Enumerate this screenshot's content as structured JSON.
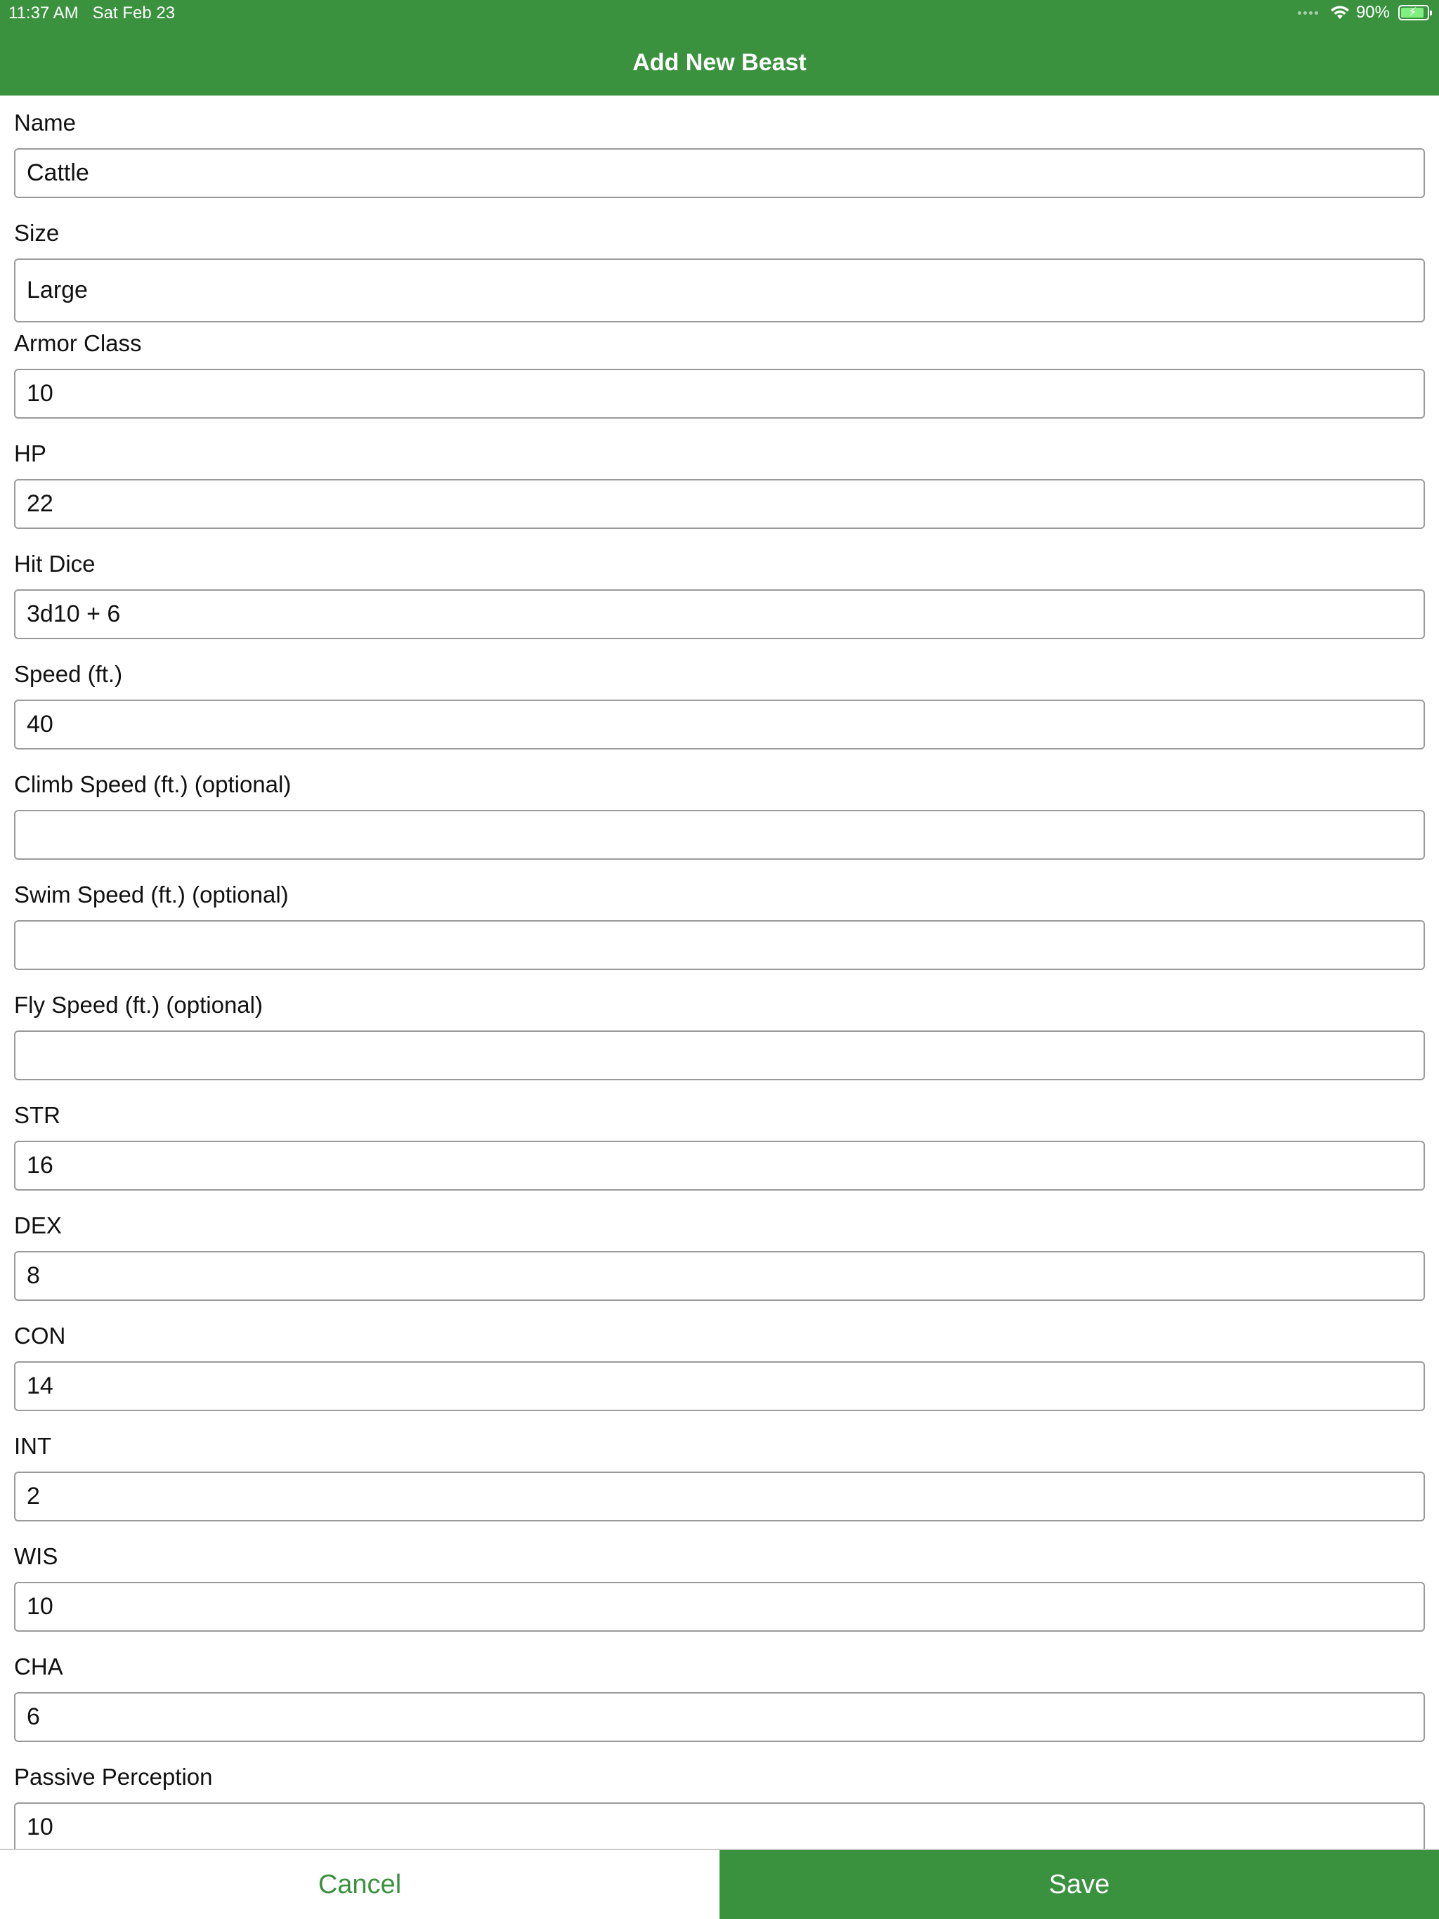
{
  "status_bar": {
    "time": "11:37 AM   Sat Feb 23",
    "wifi_icon": "wifi-icon",
    "battery_percent": "90%",
    "battery_level": 0.9,
    "battery_icon": "battery-charging-icon"
  },
  "header": {
    "title": "Add New Beast",
    "color": "#3a923e"
  },
  "form": {
    "fields": [
      {
        "label": "Name",
        "value": "Cattle"
      },
      {
        "label": "Size",
        "value": "Large"
      },
      {
        "label": "Armor Class",
        "value": "10"
      },
      {
        "label": "HP",
        "value": "22"
      },
      {
        "label": "Hit Dice",
        "value": "3d10 + 6"
      },
      {
        "label": "Speed (ft.)",
        "value": "40"
      },
      {
        "label": "Climb Speed (ft.) (optional)",
        "value": ""
      },
      {
        "label": "Swim Speed (ft.) (optional)",
        "value": ""
      },
      {
        "label": "Fly Speed (ft.) (optional)",
        "value": ""
      },
      {
        "label": "STR",
        "value": "16"
      },
      {
        "label": "DEX",
        "value": "8"
      },
      {
        "label": "CON",
        "value": "14"
      },
      {
        "label": "INT",
        "value": "2"
      },
      {
        "label": "WIS",
        "value": "10"
      },
      {
        "label": "CHA",
        "value": "6"
      },
      {
        "label": "Passive Perception",
        "value": "10"
      }
    ]
  },
  "footer": {
    "cancel_label": "Cancel",
    "save_label": "Save"
  }
}
